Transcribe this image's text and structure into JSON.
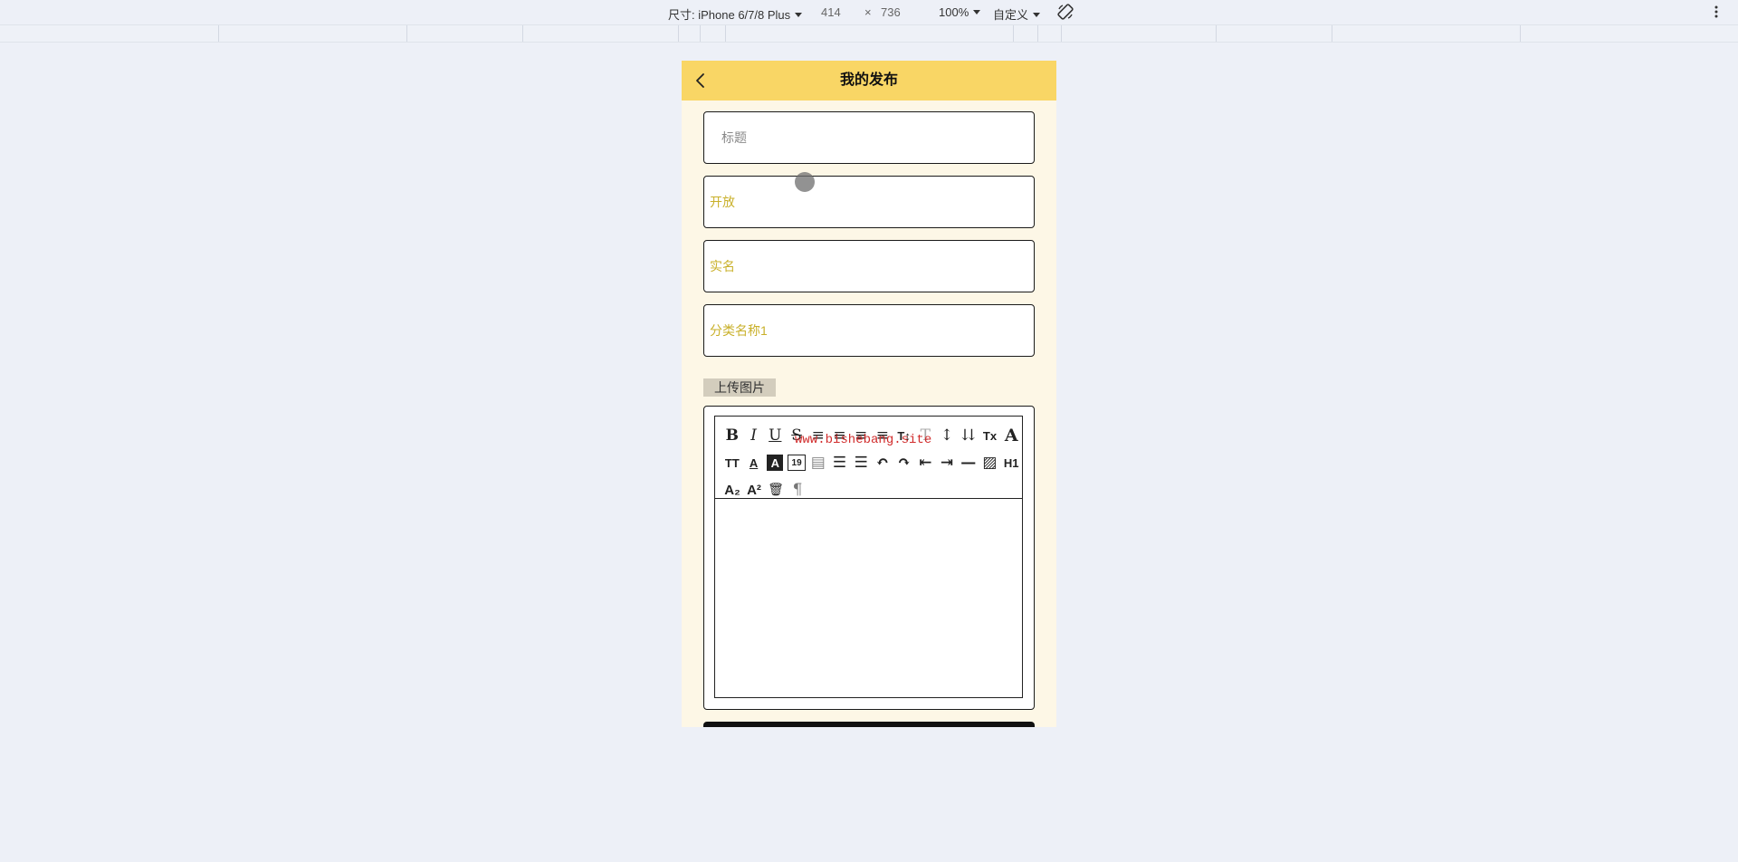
{
  "devtools": {
    "size_label": "尺寸: iPhone 6/7/8 Plus",
    "width": "414",
    "times": "×",
    "height": "736",
    "zoom": "100%",
    "throttle": "自定义",
    "rotate_icon": "rotate-icon",
    "more_icon": "more-vertical-icon"
  },
  "header": {
    "title": "我的发布",
    "back_icon": "chevron-left-icon",
    "background": "#f9d665"
  },
  "form": {
    "title_placeholder": "标题",
    "status_value": "开放",
    "realname_value": "实名",
    "category_value": "分类名称1",
    "value_color": "#c9b02a",
    "upload_label": "上传图片"
  },
  "editor": {
    "watermark": "www.bishebang.site",
    "tools_row1": [
      "B",
      "I",
      "U",
      "S",
      "≡",
      "≡",
      "≡",
      "≡",
      "T↕",
      "T",
      "↕",
      "⇊",
      "Tx",
      "A"
    ],
    "tools_row2": [
      "TT",
      "A",
      "A",
      "19",
      "▤",
      "☰",
      "☰",
      "↶",
      "↷",
      "⇤",
      "⇥",
      "—",
      "▨",
      "H1"
    ],
    "tools_row3": [
      "A₂",
      "A²",
      "🗑",
      "¶"
    ]
  }
}
